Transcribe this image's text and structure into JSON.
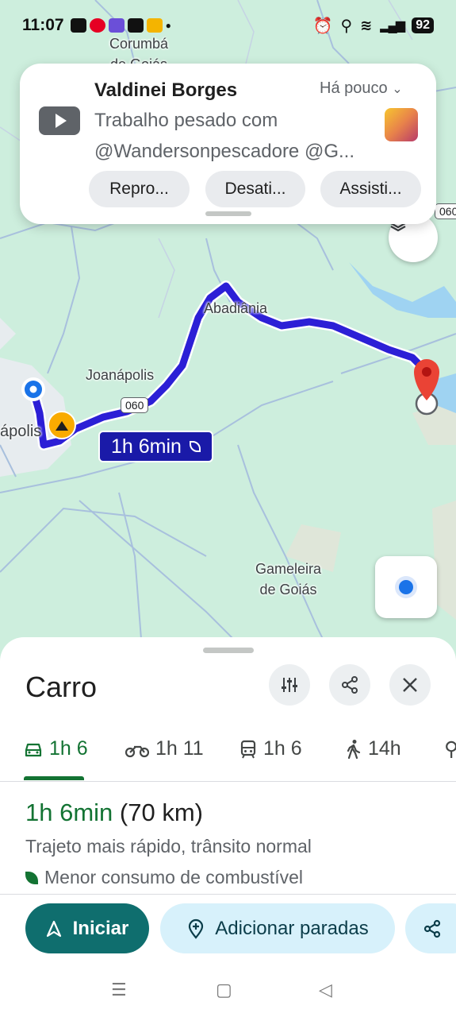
{
  "status_bar": {
    "time": "11:07",
    "battery": "92"
  },
  "notification": {
    "title": "Valdinei Borges",
    "time": "Há pouco",
    "body_line1": "Trabalho pesado com",
    "body_line2": "@Wandersonpescadore @G...",
    "actions": [
      "Repro...",
      "Desati...",
      "Assisti..."
    ]
  },
  "map": {
    "labels": {
      "corumba": "Corumbá\nde Goiás",
      "abadiania": "Abadiânia",
      "joanapolis": "Joanápolis",
      "anapolis": "ápolis",
      "gameleira": "Gameleira\nde Goiás"
    },
    "shields": {
      "route_060": "060",
      "edge_060": "060"
    },
    "route_badge": "1h 6min"
  },
  "sheet": {
    "title": "Carro",
    "modes": [
      {
        "icon": "car-icon",
        "label": "1h 6",
        "active": true
      },
      {
        "icon": "motorcycle-icon",
        "label": "1h 11",
        "active": false
      },
      {
        "icon": "transit-icon",
        "label": "1h 6",
        "active": false
      },
      {
        "icon": "walk-icon",
        "label": "14h",
        "active": false
      }
    ],
    "summary": {
      "duration": "1h 6min",
      "distance": "(70 km)",
      "description": "Trajeto mais rápido, trânsito normal",
      "eco": "Menor consumo de combustível"
    },
    "actions": {
      "start": "Iniciar",
      "add_stops": "Adicionar paradas"
    }
  },
  "colors": {
    "route": "#1a1aa8",
    "accent_green": "#137333",
    "start_button": "#0f6e6e"
  }
}
